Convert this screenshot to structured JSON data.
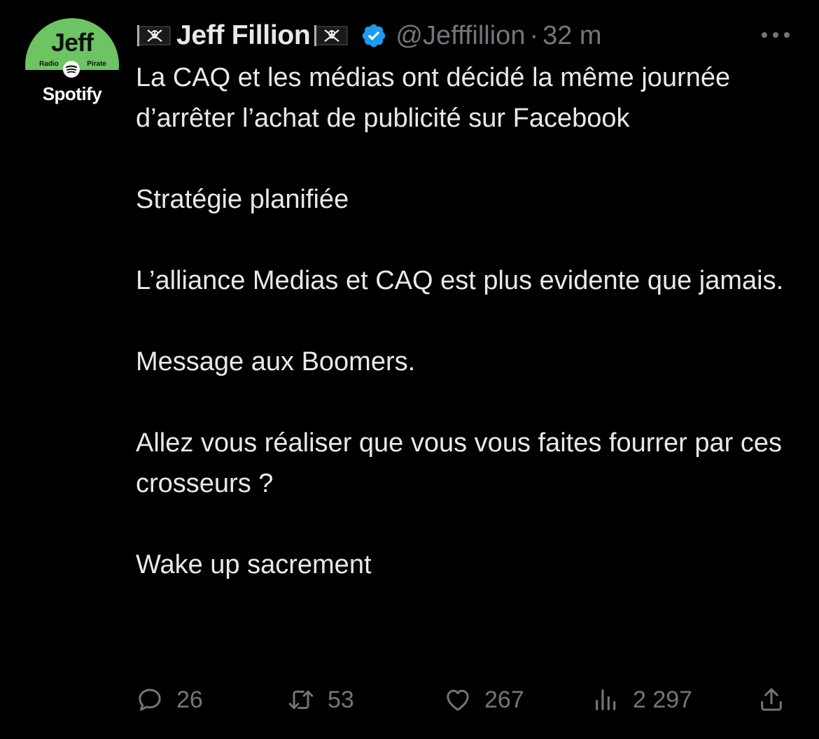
{
  "avatar": {
    "name_text": "Jeff",
    "sub_left": "Radio",
    "sub_right": "Pirate",
    "brand_text": "Spotify",
    "top_color": "#6dc463"
  },
  "author": {
    "display_name": "Jeff Fillion",
    "handle": "@Jefffillion",
    "separator": "·",
    "time_ago": "32 m",
    "verified": true,
    "name_emoji": "pirate-flag-icon"
  },
  "tweet": {
    "paragraphs": [
      "La CAQ et les médias ont décidé la même journée d’arrêter l’achat de publicité sur Facebook",
      "Stratégie planifiée",
      "L’alliance Medias et CAQ est plus evidente que jamais.",
      "Message aux Boomers.",
      "Allez vous réaliser que vous vous faites fourrer par ces crosseurs ?",
      "Wake up sacrement"
    ]
  },
  "actions": {
    "replies": "26",
    "retweets": "53",
    "likes": "267",
    "views": "2 297"
  },
  "colors": {
    "background": "#000000",
    "text": "#e7e9ea",
    "muted": "#71767b",
    "verified": "#1d9bf0"
  }
}
